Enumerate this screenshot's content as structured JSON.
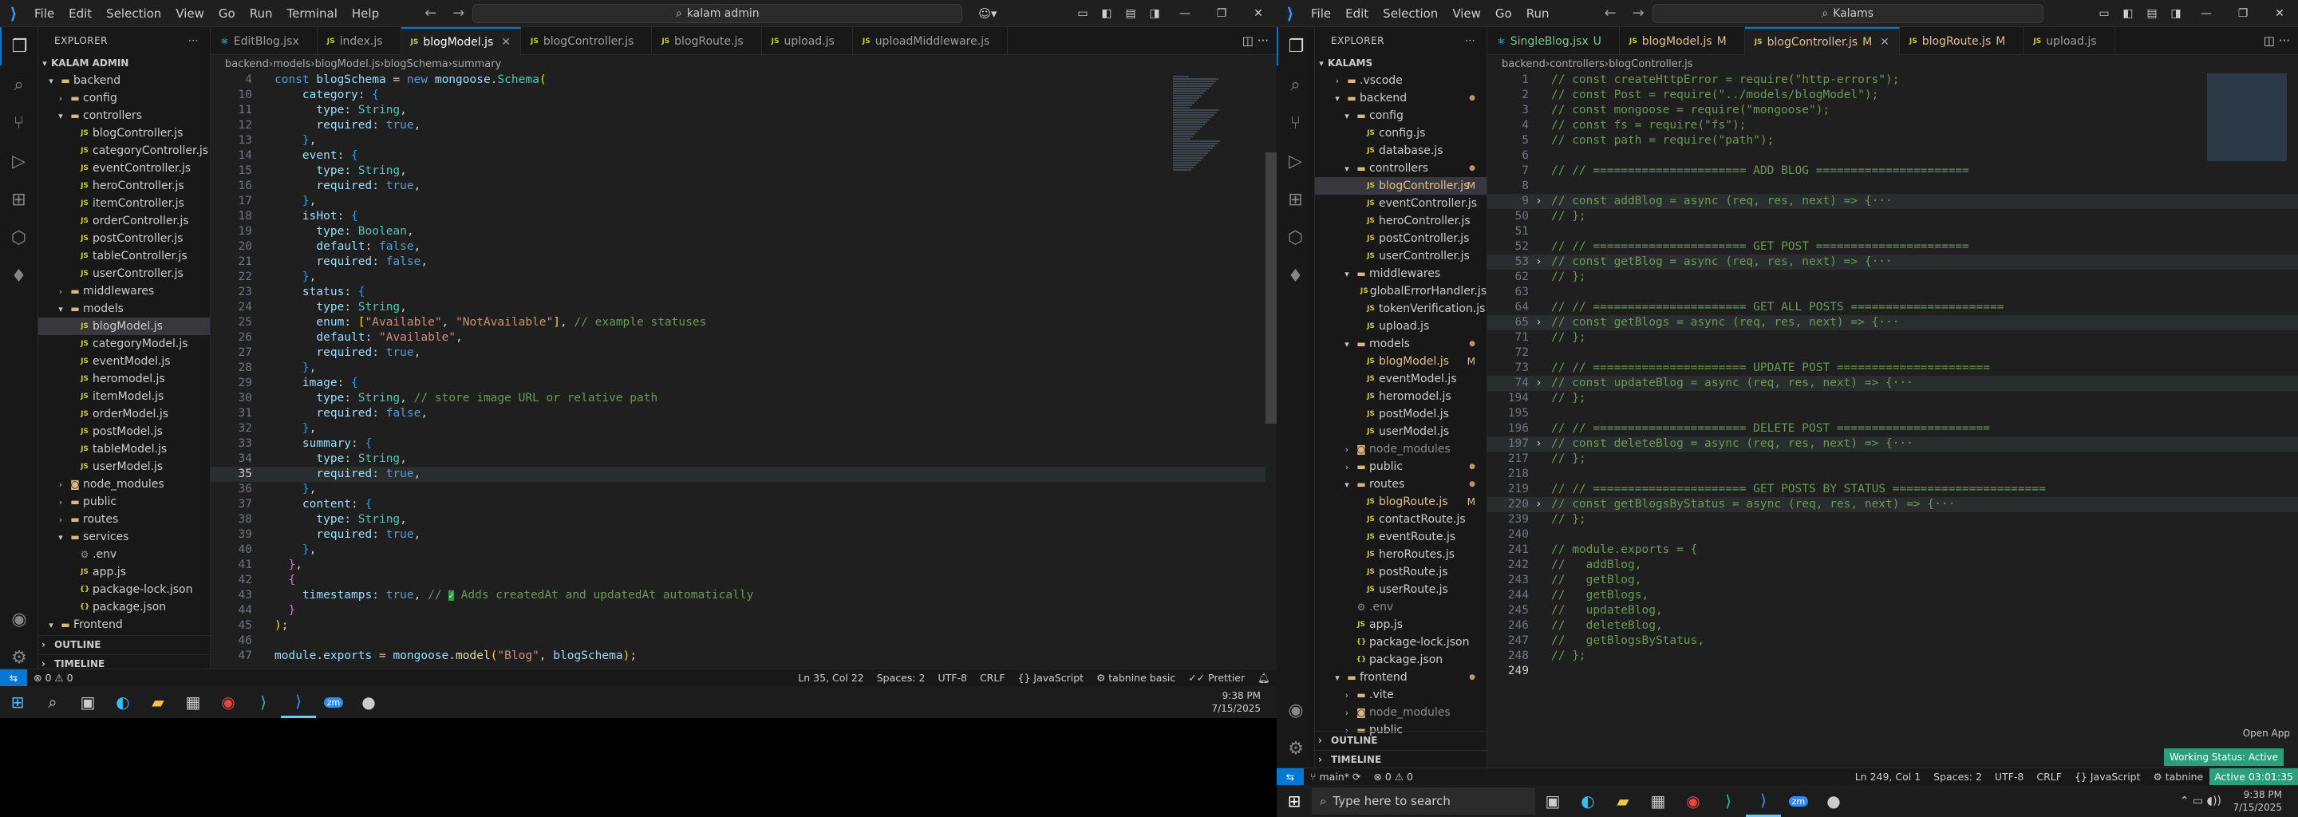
{
  "left": {
    "menu": [
      "File",
      "Edit",
      "Selection",
      "View",
      "Go",
      "Run",
      "Terminal",
      "Help"
    ],
    "search": "kalam admin",
    "explorer": {
      "title": "EXPLORER",
      "root": "KALAM ADMIN",
      "tree": [
        {
          "label": "backend",
          "type": "folder-open",
          "depth": 0
        },
        {
          "label": "config",
          "type": "folder",
          "depth": 1
        },
        {
          "label": "controllers",
          "type": "folder-open",
          "depth": 1
        },
        {
          "label": "blogController.js",
          "type": "js",
          "depth": 2
        },
        {
          "label": "categoryController.js",
          "type": "js",
          "depth": 2
        },
        {
          "label": "eventController.js",
          "type": "js",
          "depth": 2
        },
        {
          "label": "heroController.js",
          "type": "js",
          "depth": 2
        },
        {
          "label": "itemController.js",
          "type": "js",
          "depth": 2
        },
        {
          "label": "orderController.js",
          "type": "js",
          "depth": 2
        },
        {
          "label": "postController.js",
          "type": "js",
          "depth": 2
        },
        {
          "label": "tableController.js",
          "type": "js",
          "depth": 2
        },
        {
          "label": "userController.js",
          "type": "js",
          "depth": 2
        },
        {
          "label": "middlewares",
          "type": "folder",
          "depth": 1
        },
        {
          "label": "models",
          "type": "folder-open",
          "depth": 1
        },
        {
          "label": "blogModel.js",
          "type": "js",
          "depth": 2,
          "selected": true
        },
        {
          "label": "categoryModel.js",
          "type": "js",
          "depth": 2
        },
        {
          "label": "eventModel.js",
          "type": "js",
          "depth": 2
        },
        {
          "label": "heromodel.js",
          "type": "js",
          "depth": 2
        },
        {
          "label": "itemModel.js",
          "type": "js",
          "depth": 2
        },
        {
          "label": "orderModel.js",
          "type": "js",
          "depth": 2
        },
        {
          "label": "postModel.js",
          "type": "js",
          "depth": 2
        },
        {
          "label": "tableModel.js",
          "type": "js",
          "depth": 2
        },
        {
          "label": "userModel.js",
          "type": "js",
          "depth": 2
        },
        {
          "label": "node_modules",
          "type": "folder-nm",
          "depth": 1
        },
        {
          "label": "public",
          "type": "folder",
          "depth": 1
        },
        {
          "label": "routes",
          "type": "folder",
          "depth": 1
        },
        {
          "label": "services",
          "type": "folder-open",
          "depth": 1
        },
        {
          "label": ".env",
          "type": "env",
          "depth": 2
        },
        {
          "label": "app.js",
          "type": "js",
          "depth": 2
        },
        {
          "label": "package-lock.json",
          "type": "json",
          "depth": 2
        },
        {
          "label": "package.json",
          "type": "json",
          "depth": 2
        },
        {
          "label": "Frontend",
          "type": "folder-open",
          "depth": 0
        }
      ],
      "outline": "OUTLINE",
      "timeline": "TIMELINE"
    },
    "tabs": [
      {
        "label": "EditBlog.jsx",
        "icon": "jsx"
      },
      {
        "label": "index.js",
        "icon": "js"
      },
      {
        "label": "blogModel.js",
        "icon": "js",
        "active": true
      },
      {
        "label": "blogController.js",
        "icon": "js"
      },
      {
        "label": "blogRoute.js",
        "icon": "js"
      },
      {
        "label": "upload.js",
        "icon": "js"
      },
      {
        "label": "uploadMiddleware.js",
        "icon": "js"
      }
    ],
    "breadcrumb": [
      "backend",
      "models",
      "blogModel.js",
      "blogSchema",
      "summary"
    ],
    "status": {
      "errors": "0",
      "warnings": "0",
      "position": "Ln 35, Col 22",
      "spaces": "Spaces: 2",
      "encoding": "UTF-8",
      "eol": "CRLF",
      "language": "JavaScript",
      "tabnine": "tabnine basic",
      "prettier": "Prettier"
    },
    "time": "9:38 PM",
    "date": "7/15/2025"
  },
  "right": {
    "menu": [
      "File",
      "Edit",
      "Selection",
      "View",
      "Go",
      "Run"
    ],
    "search": "Kalams",
    "explorer": {
      "title": "EXPLORER",
      "root": "KALAMS",
      "tree": [
        {
          "label": ".vscode",
          "type": "folder",
          "depth": 1
        },
        {
          "label": "backend",
          "type": "folder-open",
          "depth": 1,
          "dot": true
        },
        {
          "label": "config",
          "type": "folder-open",
          "depth": 2
        },
        {
          "label": "config.js",
          "type": "js",
          "depth": 3
        },
        {
          "label": "database.js",
          "type": "js",
          "depth": 3
        },
        {
          "label": "controllers",
          "type": "folder-open",
          "depth": 2,
          "dot": true
        },
        {
          "label": "blogController.js",
          "type": "js",
          "depth": 3,
          "badge": "M",
          "modified": true,
          "selected": true
        },
        {
          "label": "eventController.js",
          "type": "js",
          "depth": 3
        },
        {
          "label": "heroController.js",
          "type": "js",
          "depth": 3
        },
        {
          "label": "postController.js",
          "type": "js",
          "depth": 3
        },
        {
          "label": "userController.js",
          "type": "js",
          "depth": 3
        },
        {
          "label": "middlewares",
          "type": "folder-open",
          "depth": 2
        },
        {
          "label": "globalErrorHandler.js",
          "type": "js",
          "depth": 3
        },
        {
          "label": "tokenVerification.js",
          "type": "js",
          "depth": 3
        },
        {
          "label": "upload.js",
          "type": "js",
          "depth": 3
        },
        {
          "label": "models",
          "type": "folder-open",
          "depth": 2,
          "dot": true
        },
        {
          "label": "blogModel.js",
          "type": "js",
          "depth": 3,
          "badge": "M",
          "modified": true
        },
        {
          "label": "eventModel.js",
          "type": "js",
          "depth": 3
        },
        {
          "label": "heromodel.js",
          "type": "js",
          "depth": 3
        },
        {
          "label": "postModel.js",
          "type": "js",
          "depth": 3
        },
        {
          "label": "userModel.js",
          "type": "js",
          "depth": 3
        },
        {
          "label": "node_modules",
          "type": "folder-nm",
          "depth": 2,
          "ignored": true
        },
        {
          "label": "public",
          "type": "folder",
          "depth": 2,
          "dot": true
        },
        {
          "label": "routes",
          "type": "folder-open",
          "depth": 2,
          "dot": true
        },
        {
          "label": "blogRoute.js",
          "type": "js",
          "depth": 3,
          "badge": "M",
          "modified": true
        },
        {
          "label": "contactRoute.js",
          "type": "js",
          "depth": 3
        },
        {
          "label": "eventRoute.js",
          "type": "js",
          "depth": 3
        },
        {
          "label": "heroRoutes.js",
          "type": "js",
          "depth": 3
        },
        {
          "label": "postRoute.js",
          "type": "js",
          "depth": 3
        },
        {
          "label": "userRoute.js",
          "type": "js",
          "depth": 3
        },
        {
          "label": ".env",
          "type": "env",
          "depth": 2,
          "ignored": true
        },
        {
          "label": "app.js",
          "type": "js",
          "depth": 2
        },
        {
          "label": "package-lock.json",
          "type": "json",
          "depth": 2
        },
        {
          "label": "package.json",
          "type": "json",
          "depth": 2
        },
        {
          "label": "frontend",
          "type": "folder-open",
          "depth": 1,
          "dot": true
        },
        {
          "label": ".vite",
          "type": "folder",
          "depth": 2
        },
        {
          "label": "node_modules",
          "type": "folder-nm",
          "depth": 2,
          "ignored": true
        },
        {
          "label": "public",
          "type": "folder",
          "depth": 2
        }
      ],
      "outline": "OUTLINE",
      "timeline": "TIMELINE"
    },
    "tabs": [
      {
        "label": "SingleBlog.jsx",
        "icon": "jsx",
        "badge": "U",
        "untracked": true
      },
      {
        "label": "blogModel.js",
        "icon": "js",
        "badge": "M",
        "modified": true
      },
      {
        "label": "blogController.js",
        "icon": "js",
        "badge": "M",
        "modified": true,
        "active": true
      },
      {
        "label": "blogRoute.js",
        "icon": "js",
        "badge": "M",
        "modified": true
      },
      {
        "label": "upload.js",
        "icon": "js"
      }
    ],
    "breadcrumb": [
      "backend",
      "controllers",
      "blogController.js"
    ],
    "status": {
      "branch": "main*",
      "errors": "0",
      "warnings": "0",
      "position": "Ln 249, Col 1",
      "spaces": "Spaces: 2",
      "encoding": "UTF-8",
      "eol": "CRLF",
      "language": "JavaScript",
      "tabnine": "tabnine"
    },
    "open_app": "Open App",
    "working_status": "Working Status: Active",
    "active_timer": "Active 03:01:35",
    "taskbar_search": "Type here to search",
    "time": "9:38 PM",
    "date": "7/15/2025"
  }
}
